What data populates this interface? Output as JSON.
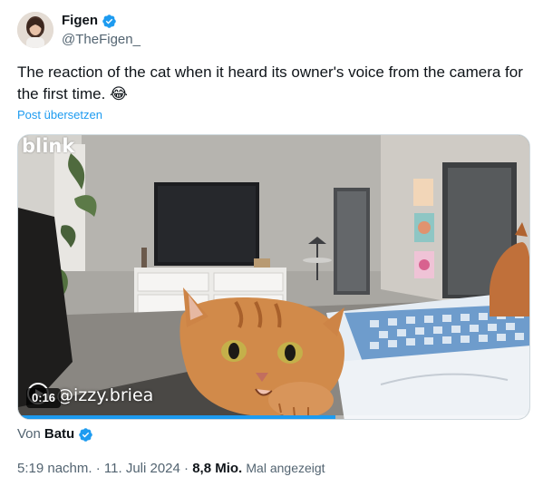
{
  "author": {
    "name": "Figen",
    "handle": "@TheFigen_",
    "verified": true
  },
  "tweet": {
    "text": "The reaction of the cat when it heard its owner's voice from the camera for the first time. 😂",
    "translate_label": "Post übersetzen"
  },
  "media": {
    "brand_logo": "blink",
    "watermark": "@izzy.briea",
    "timer": "0:16",
    "progress": 0.62
  },
  "attribution": {
    "prefix": "Von",
    "author": "Batu",
    "verified": true
  },
  "meta": {
    "time": "5:19 nachm.",
    "separator": " · ",
    "date": "11. Juli 2024",
    "views_count": "8,8 Mio.",
    "views_label": "Mal angezeigt"
  },
  "colors": {
    "accent": "#1d9bf0",
    "text": "#0f1419",
    "muted": "#536471"
  }
}
